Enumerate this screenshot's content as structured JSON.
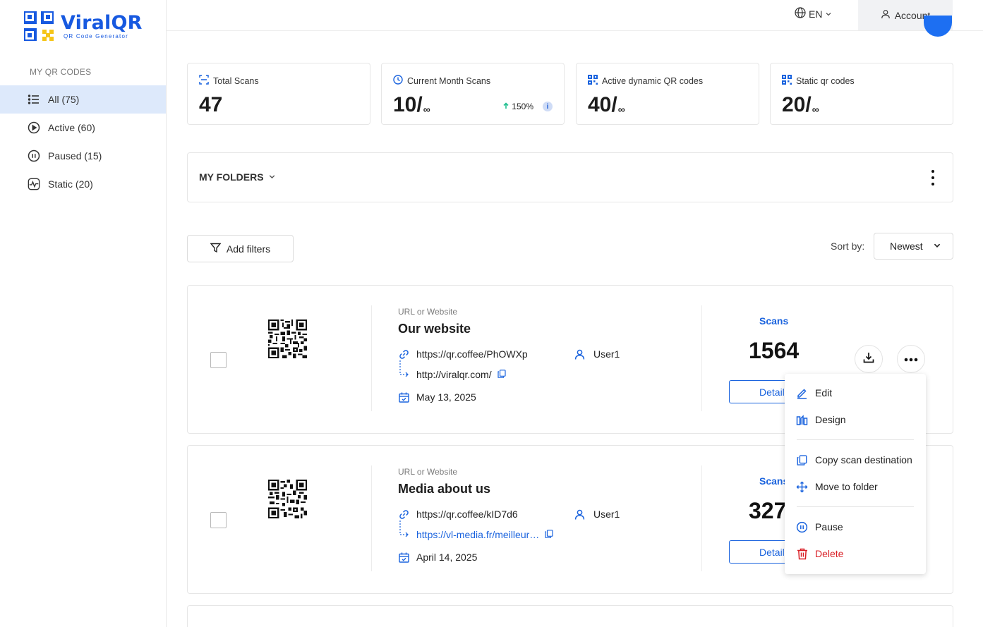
{
  "brand": {
    "name": "ViralQR",
    "tagline": "QR Code Generator",
    "color": "#1759e0",
    "accent_yellow": "#f5c518"
  },
  "sidebar": {
    "heading": "MY QR CODES",
    "items": [
      {
        "label": "All (75)",
        "icon": "list-icon",
        "active": true
      },
      {
        "label": "Active (60)",
        "icon": "play-circle-icon",
        "active": false
      },
      {
        "label": "Paused (15)",
        "icon": "pause-circle-icon",
        "active": false
      },
      {
        "label": "Static (20)",
        "icon": "pulse-icon",
        "active": false
      }
    ]
  },
  "topbar": {
    "language": "EN",
    "account_label": "Account"
  },
  "stats": [
    {
      "label": "Total Scans",
      "value": "47",
      "limit": "",
      "icon": "scan-frame-icon"
    },
    {
      "label": "Current Month Scans",
      "value": "10/",
      "limit": "∞",
      "icon": "clock-icon",
      "trend": "150%"
    },
    {
      "label": "Active dynamic QR codes",
      "value": "40/",
      "limit": "∞",
      "icon": "qr-grid-icon"
    },
    {
      "label": "Static qr codes",
      "value": "20/",
      "limit": "∞",
      "icon": "qr-grid-icon"
    }
  ],
  "folders": {
    "title": "MY FOLDERS"
  },
  "filters": {
    "add_label": "Add filters",
    "sort_label": "Sort by:",
    "sort_value": "Newest"
  },
  "cards": [
    {
      "type": "URL or Website",
      "name": "Our website",
      "short_url": "https://qr.coffee/PhOWXp",
      "destination": "http://viralqr.com/",
      "destination_link": false,
      "user": "User1",
      "date": "May 13, 2025",
      "scans_label": "Scans",
      "scans": "1564",
      "details_label": "Details"
    },
    {
      "type": "URL or Website",
      "name": "Media about us",
      "short_url": "https://qr.coffee/kID7d6",
      "destination": "https://vl-media.fr/meilleur…",
      "destination_link": true,
      "user": "User1",
      "date": "April 14, 2025",
      "scans_label": "Scans",
      "scans": "327",
      "details_label": "Details"
    }
  ],
  "menu": {
    "items": [
      {
        "label": "Edit",
        "icon": "pencil-icon"
      },
      {
        "label": "Design",
        "icon": "palette-icon"
      },
      {
        "label": "Copy scan destination",
        "icon": "copy-icon"
      },
      {
        "label": "Move to folder",
        "icon": "move-icon"
      },
      {
        "label": "Pause",
        "icon": "pause-circle-icon"
      },
      {
        "label": "Delete",
        "icon": "trash-icon",
        "danger": true
      }
    ]
  },
  "colors": {
    "primary": "#1a63de",
    "danger": "#d91f26",
    "sidebar_active": "#dde9fb",
    "trend_up": "#1fbf8f"
  }
}
